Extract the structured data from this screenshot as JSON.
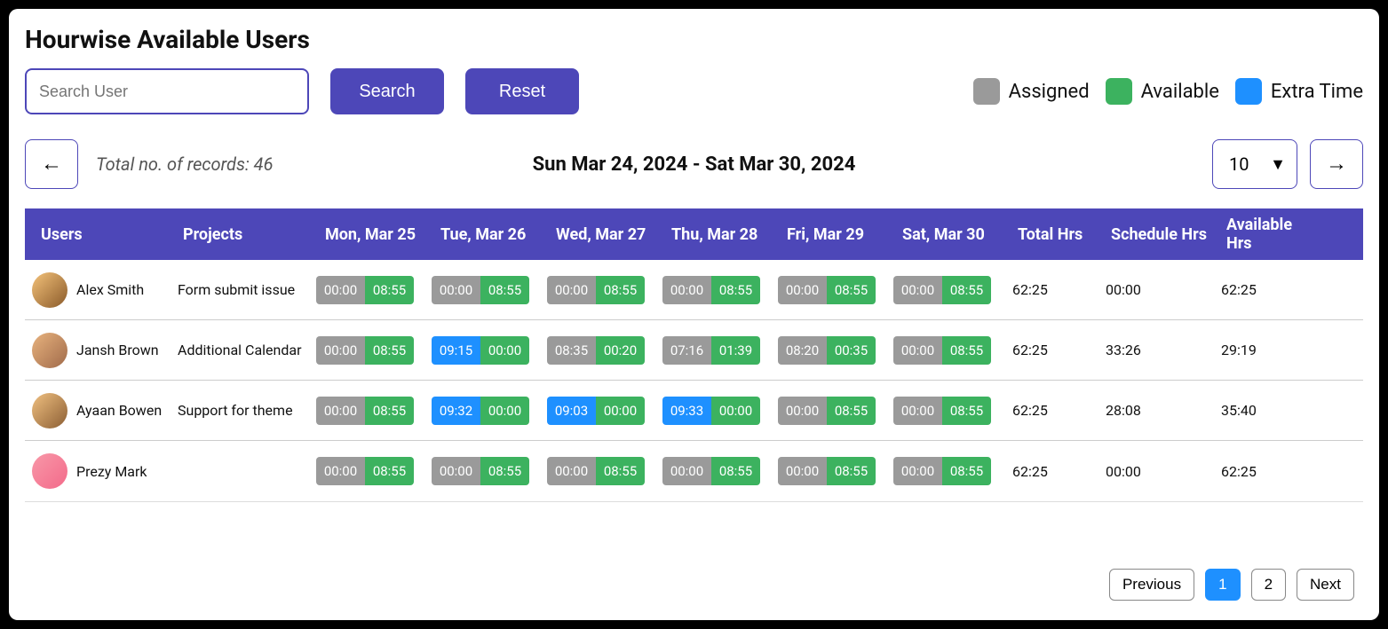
{
  "title": "Hourwise Available Users",
  "search": {
    "placeholder": "Search User",
    "search_label": "Search",
    "reset_label": "Reset"
  },
  "legend": {
    "assigned": {
      "label": "Assigned",
      "color": "#9a9a9a"
    },
    "available": {
      "label": "Available",
      "color": "#3cb25f"
    },
    "extra": {
      "label": "Extra Time",
      "color": "#1e90ff"
    }
  },
  "meta": {
    "records_text": "Total no. of records: 46",
    "date_range": "Sun Mar 24, 2024 - Sat Mar 30, 2024",
    "page_size": "10"
  },
  "columns": {
    "users": "Users",
    "projects": "Projects",
    "d0": "Mon, Mar 25",
    "d1": "Tue, Mar 26",
    "d2": "Wed, Mar 27",
    "d3": "Thu, Mar 28",
    "d4": "Fri, Mar 29",
    "d5": "Sat, Mar 30",
    "total": "Total Hrs",
    "schedule": "Schedule Hrs",
    "available": "Available Hrs"
  },
  "rows": [
    {
      "user": "Alex Smith",
      "project": "Form submit issue",
      "days": [
        {
          "a": "00:00",
          "b": "08:55",
          "ca": "gray",
          "cb": "green"
        },
        {
          "a": "00:00",
          "b": "08:55",
          "ca": "gray",
          "cb": "green"
        },
        {
          "a": "00:00",
          "b": "08:55",
          "ca": "gray",
          "cb": "green"
        },
        {
          "a": "00:00",
          "b": "08:55",
          "ca": "gray",
          "cb": "green"
        },
        {
          "a": "00:00",
          "b": "08:55",
          "ca": "gray",
          "cb": "green"
        },
        {
          "a": "00:00",
          "b": "08:55",
          "ca": "gray",
          "cb": "green"
        }
      ],
      "total": "62:25",
      "schedule": "00:00",
      "available": "62:25"
    },
    {
      "user": "Jansh Brown",
      "project": "Additional Calendar",
      "days": [
        {
          "a": "00:00",
          "b": "08:55",
          "ca": "gray",
          "cb": "green"
        },
        {
          "a": "09:15",
          "b": "00:00",
          "ca": "blue",
          "cb": "green"
        },
        {
          "a": "08:35",
          "b": "00:20",
          "ca": "gray",
          "cb": "green"
        },
        {
          "a": "07:16",
          "b": "01:39",
          "ca": "gray",
          "cb": "green"
        },
        {
          "a": "08:20",
          "b": "00:35",
          "ca": "gray",
          "cb": "green"
        },
        {
          "a": "00:00",
          "b": "08:55",
          "ca": "gray",
          "cb": "green"
        }
      ],
      "total": "62:25",
      "schedule": "33:26",
      "available": "29:19"
    },
    {
      "user": "Ayaan Bowen",
      "project": "Support for theme",
      "days": [
        {
          "a": "00:00",
          "b": "08:55",
          "ca": "gray",
          "cb": "green"
        },
        {
          "a": "09:32",
          "b": "00:00",
          "ca": "blue",
          "cb": "green"
        },
        {
          "a": "09:03",
          "b": "00:00",
          "ca": "blue",
          "cb": "green"
        },
        {
          "a": "09:33",
          "b": "00:00",
          "ca": "blue",
          "cb": "green"
        },
        {
          "a": "00:00",
          "b": "08:55",
          "ca": "gray",
          "cb": "green"
        },
        {
          "a": "00:00",
          "b": "08:55",
          "ca": "gray",
          "cb": "green"
        }
      ],
      "total": "62:25",
      "schedule": "28:08",
      "available": "35:40"
    },
    {
      "user": "Prezy Mark",
      "project": "",
      "days": [
        {
          "a": "00:00",
          "b": "08:55",
          "ca": "gray",
          "cb": "green"
        },
        {
          "a": "00:00",
          "b": "08:55",
          "ca": "gray",
          "cb": "green"
        },
        {
          "a": "00:00",
          "b": "08:55",
          "ca": "gray",
          "cb": "green"
        },
        {
          "a": "00:00",
          "b": "08:55",
          "ca": "gray",
          "cb": "green"
        },
        {
          "a": "00:00",
          "b": "08:55",
          "ca": "gray",
          "cb": "green"
        },
        {
          "a": "00:00",
          "b": "08:55",
          "ca": "gray",
          "cb": "green"
        }
      ],
      "total": "62:25",
      "schedule": "00:00",
      "available": "62:25"
    }
  ],
  "pagination": {
    "previous": "Previous",
    "p1": "1",
    "p2": "2",
    "next": "Next"
  }
}
